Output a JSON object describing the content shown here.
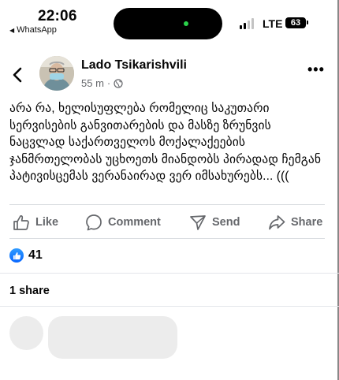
{
  "status_bar": {
    "time": "22:06",
    "back_app": "WhatsApp",
    "network": "LTE",
    "battery": "63"
  },
  "post": {
    "author": "Lado Tsikarishvili",
    "time_ago": "55 m",
    "separator": "·",
    "audience_icon": "globe-icon",
    "text": "არა რა, ხელისუფლება რომელიც საკუთარი სერვისების განვითარების და მასზე ზრუნვის ნაცვლად საქართველოს მოქალაქეების ჯანმრთელობას უცხოეთს მიანდობს პირადად ჩემგან პატივისცემას ვერანაირად ვერ იმსახურებს... (((",
    "more_label": "•••"
  },
  "actions": {
    "like": "Like",
    "comment": "Comment",
    "send": "Send",
    "share": "Share"
  },
  "engagement": {
    "reaction_count": "41",
    "shares": "1 share"
  },
  "colors": {
    "accent": "#0866ff",
    "secondary_text": "#65676b",
    "placeholder": "#ececec"
  }
}
